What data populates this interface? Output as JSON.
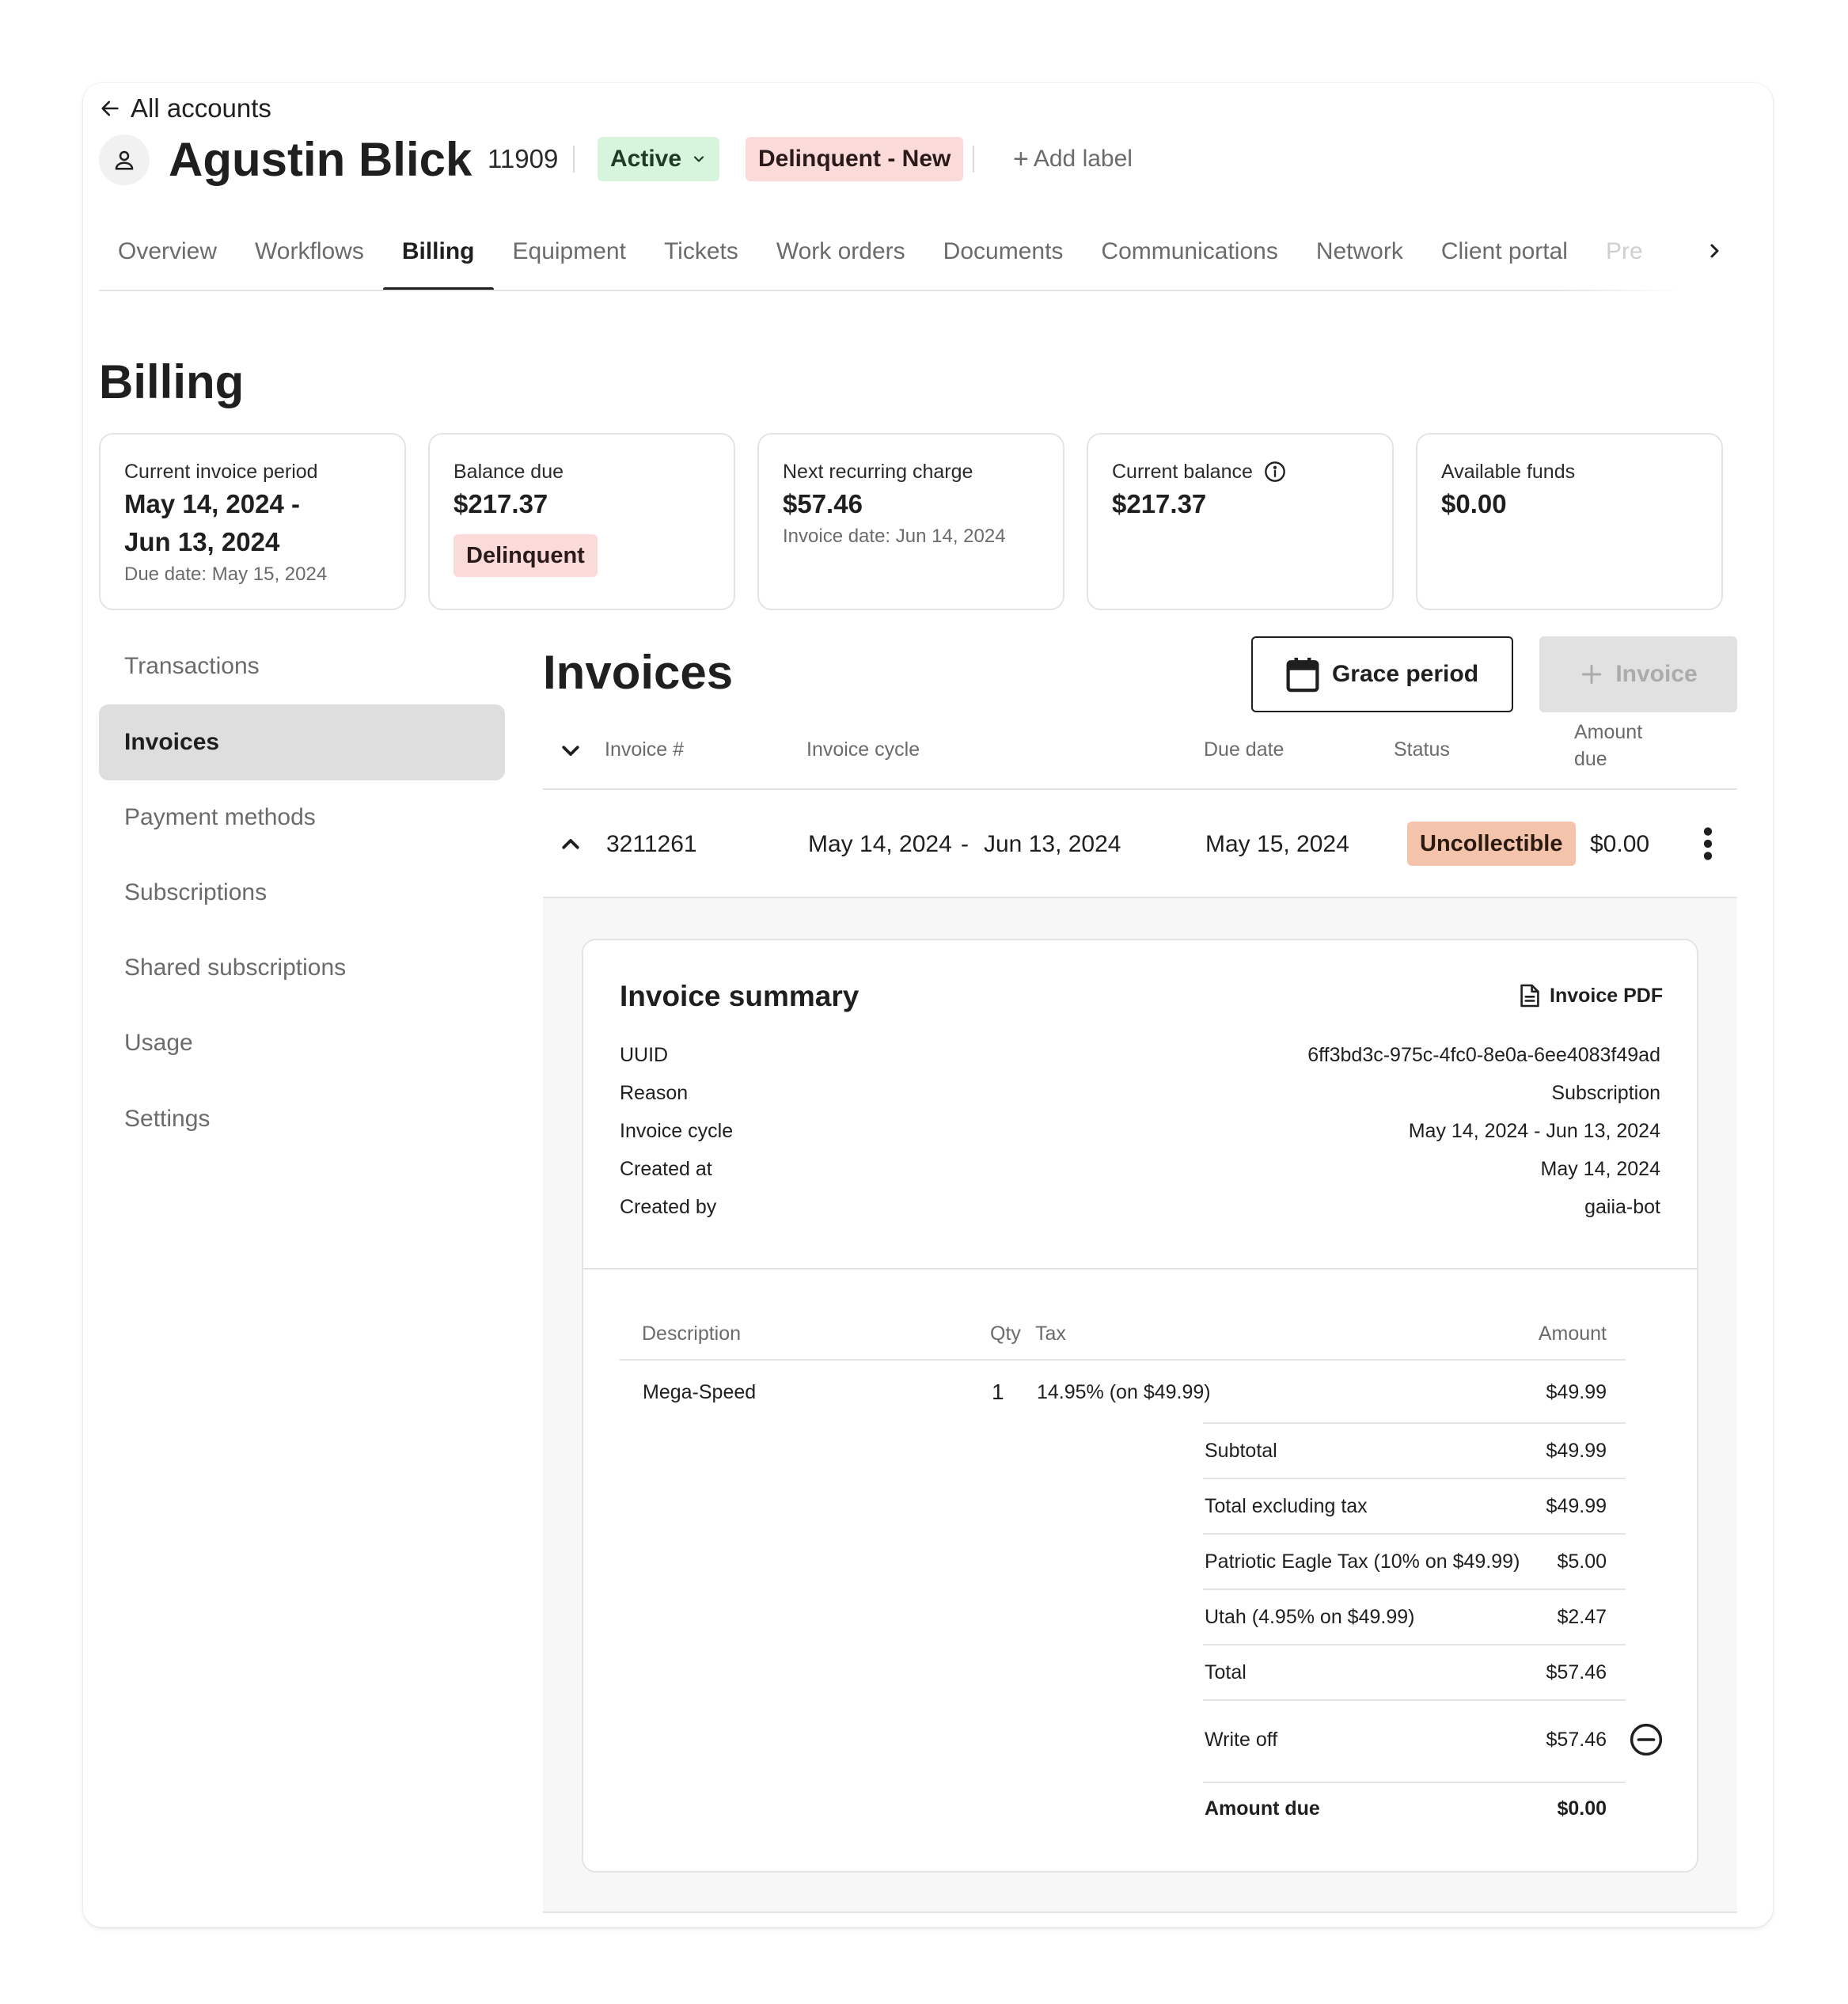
{
  "header": {
    "back_label": "All accounts",
    "account_name": "Agustin Blick",
    "account_id": "11909",
    "status_label": "Active",
    "delinquency_label": "Delinquent - New",
    "add_label": "Add label",
    "colors": {
      "active_bg": "#d6f5dc",
      "delinquent_bg": "#fbdada"
    }
  },
  "tabs": [
    {
      "label": "Overview"
    },
    {
      "label": "Workflows"
    },
    {
      "label": "Billing",
      "active": true
    },
    {
      "label": "Equipment"
    },
    {
      "label": "Tickets"
    },
    {
      "label": "Work orders"
    },
    {
      "label": "Documents"
    },
    {
      "label": "Communications"
    },
    {
      "label": "Network"
    },
    {
      "label": "Client portal"
    },
    {
      "label": "Pref"
    }
  ],
  "page_title": "Billing",
  "stats": {
    "period": {
      "label": "Current invoice period",
      "line1": "May 14, 2024  -",
      "line2": "Jun 13, 2024",
      "sub": "Due date: May 15, 2024"
    },
    "balance_due": {
      "label": "Balance due",
      "value": "$217.37",
      "badge": "Delinquent"
    },
    "next_charge": {
      "label": "Next recurring charge",
      "value": "$57.46",
      "sub": "Invoice date: Jun 14, 2024"
    },
    "current_balance": {
      "label": "Current balance",
      "value": "$217.37"
    },
    "available_funds": {
      "label": "Available funds",
      "value": "$0.00"
    }
  },
  "sidebar": {
    "items": [
      {
        "label": "Transactions"
      },
      {
        "label": "Invoices",
        "active": true
      },
      {
        "label": "Payment methods"
      },
      {
        "label": "Subscriptions"
      },
      {
        "label": "Shared subscriptions"
      },
      {
        "label": "Usage"
      },
      {
        "label": "Settings"
      }
    ]
  },
  "invoices": {
    "title": "Invoices",
    "grace_button": "Grace period",
    "new_invoice_button": "Invoice",
    "columns": {
      "number": "Invoice #",
      "cycle": "Invoice cycle",
      "due": "Due date",
      "status": "Status",
      "amount_line1": "Amount",
      "amount_line2": "due"
    },
    "rows": [
      {
        "number": "3211261",
        "cycle_start": "May 14, 2024",
        "cycle_sep": "-",
        "cycle_end": "Jun 13, 2024",
        "due": "May 15, 2024",
        "status": "Uncollectible",
        "amount": "$0.00"
      }
    ]
  },
  "summary": {
    "title": "Invoice summary",
    "pdf_label": "Invoice PDF",
    "fields": [
      {
        "label": "UUID",
        "value": "6ff3bd3c-975c-4fc0-8e0a-6ee4083f49ad"
      },
      {
        "label": "Reason",
        "value": "Subscription"
      },
      {
        "label": "Invoice cycle",
        "value": "May 14, 2024 - Jun 13, 2024"
      },
      {
        "label": "Created at",
        "value": "May 14, 2024"
      },
      {
        "label": "Created by",
        "value": "gaiia-bot"
      }
    ],
    "line_table": {
      "headers": {
        "description": "Description",
        "qty": "Qty",
        "tax": "Tax",
        "amount": "Amount"
      },
      "items": [
        {
          "description": "Mega-Speed",
          "qty": "1",
          "tax": "14.95% (on $49.99)",
          "amount": "$49.99"
        }
      ],
      "totals": [
        {
          "label": "Subtotal",
          "value": "$49.99"
        },
        {
          "label": "Total excluding tax",
          "value": "$49.99"
        },
        {
          "label": "Patriotic Eagle Tax (10% on $49.99)",
          "value": "$5.00"
        },
        {
          "label": "Utah (4.95% on $49.99)",
          "value": "$2.47"
        },
        {
          "label": "Total",
          "value": "$57.46"
        },
        {
          "label": "Write off",
          "value": "$57.46"
        },
        {
          "label": "Amount due",
          "value": "$0.00"
        }
      ]
    }
  }
}
